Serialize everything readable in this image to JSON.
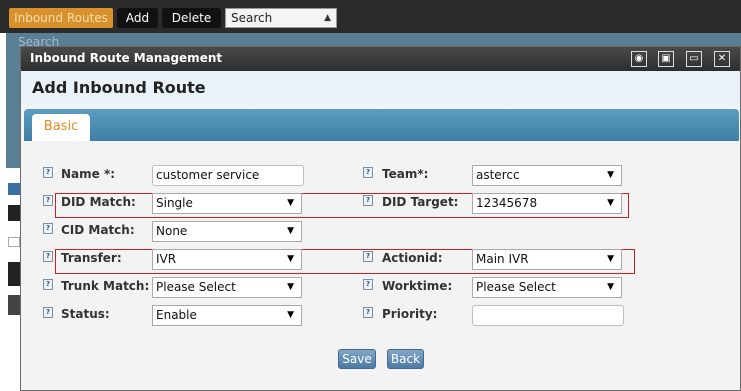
{
  "background": {
    "tab_label": "Inbound Routes",
    "add_label": "Add",
    "delete_label": "Delete",
    "search_select": "Search",
    "search_text": "Search"
  },
  "modal": {
    "window_title": "Inbound Route Management",
    "heading": "Add Inbound Route",
    "tab_label": "Basic",
    "fields": {
      "name": {
        "label": "Name *:",
        "value": "customer service"
      },
      "team": {
        "label": "Team*:",
        "value": "astercc"
      },
      "did_match": {
        "label": "DID Match:",
        "value": "Single"
      },
      "did_target": {
        "label": "DID Target:",
        "value": "12345678"
      },
      "cid_match": {
        "label": "CID Match:",
        "value": "None"
      },
      "transfer": {
        "label": "Transfer:",
        "value": "IVR"
      },
      "actionid": {
        "label": "Actionid:",
        "value": "Main IVR"
      },
      "trunk_match": {
        "label": "Trunk Match:",
        "value": "Please Select"
      },
      "worktime": {
        "label": "Worktime:",
        "value": "Please Select"
      },
      "status": {
        "label": "Status:",
        "value": "Enable"
      },
      "priority": {
        "label": "Priority:",
        "value": ""
      }
    },
    "save_label": "Save",
    "back_label": "Back"
  },
  "colors": {
    "accent_orange": "#e58a1f",
    "highlight_red": "#cc2222",
    "tab_blue": "#4f8db2"
  },
  "icons": [
    "help-icon",
    "restore-icon",
    "maximize-icon",
    "minimize-icon",
    "close-icon",
    "dropdown-arrow-icon"
  ]
}
